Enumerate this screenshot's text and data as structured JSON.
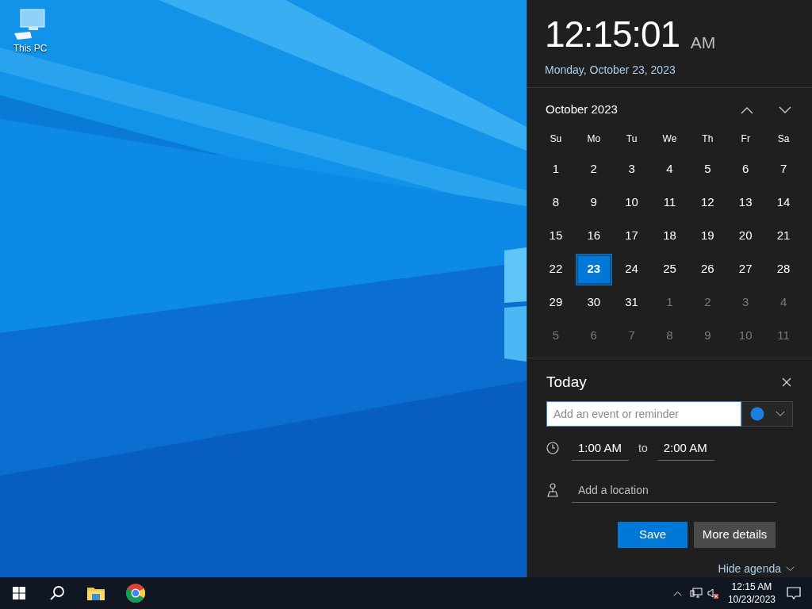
{
  "desktop": {
    "icons": [
      {
        "label": "This PC"
      }
    ]
  },
  "clock": {
    "time": "12:15:01",
    "period": "AM",
    "date": "Monday, October 23, 2023"
  },
  "calendar": {
    "month": "October 2023",
    "weekdays": [
      "Su",
      "Mo",
      "Tu",
      "We",
      "Th",
      "Fr",
      "Sa"
    ],
    "days": [
      {
        "label": "1",
        "in_month": true,
        "selected": false
      },
      {
        "label": "2",
        "in_month": true,
        "selected": false
      },
      {
        "label": "3",
        "in_month": true,
        "selected": false
      },
      {
        "label": "4",
        "in_month": true,
        "selected": false
      },
      {
        "label": "5",
        "in_month": true,
        "selected": false
      },
      {
        "label": "6",
        "in_month": true,
        "selected": false
      },
      {
        "label": "7",
        "in_month": true,
        "selected": false
      },
      {
        "label": "8",
        "in_month": true,
        "selected": false
      },
      {
        "label": "9",
        "in_month": true,
        "selected": false
      },
      {
        "label": "10",
        "in_month": true,
        "selected": false
      },
      {
        "label": "11",
        "in_month": true,
        "selected": false
      },
      {
        "label": "12",
        "in_month": true,
        "selected": false
      },
      {
        "label": "13",
        "in_month": true,
        "selected": false
      },
      {
        "label": "14",
        "in_month": true,
        "selected": false
      },
      {
        "label": "15",
        "in_month": true,
        "selected": false
      },
      {
        "label": "16",
        "in_month": true,
        "selected": false
      },
      {
        "label": "17",
        "in_month": true,
        "selected": false
      },
      {
        "label": "18",
        "in_month": true,
        "selected": false
      },
      {
        "label": "19",
        "in_month": true,
        "selected": false
      },
      {
        "label": "20",
        "in_month": true,
        "selected": false
      },
      {
        "label": "21",
        "in_month": true,
        "selected": false
      },
      {
        "label": "22",
        "in_month": true,
        "selected": false
      },
      {
        "label": "23",
        "in_month": true,
        "selected": true
      },
      {
        "label": "24",
        "in_month": true,
        "selected": false
      },
      {
        "label": "25",
        "in_month": true,
        "selected": false
      },
      {
        "label": "26",
        "in_month": true,
        "selected": false
      },
      {
        "label": "27",
        "in_month": true,
        "selected": false
      },
      {
        "label": "28",
        "in_month": true,
        "selected": false
      },
      {
        "label": "29",
        "in_month": true,
        "selected": false
      },
      {
        "label": "30",
        "in_month": true,
        "selected": false
      },
      {
        "label": "31",
        "in_month": true,
        "selected": false
      },
      {
        "label": "1",
        "in_month": false,
        "selected": false
      },
      {
        "label": "2",
        "in_month": false,
        "selected": false
      },
      {
        "label": "3",
        "in_month": false,
        "selected": false
      },
      {
        "label": "4",
        "in_month": false,
        "selected": false
      },
      {
        "label": "5",
        "in_month": false,
        "selected": false
      },
      {
        "label": "6",
        "in_month": false,
        "selected": false
      },
      {
        "label": "7",
        "in_month": false,
        "selected": false
      },
      {
        "label": "8",
        "in_month": false,
        "selected": false
      },
      {
        "label": "9",
        "in_month": false,
        "selected": false
      },
      {
        "label": "10",
        "in_month": false,
        "selected": false
      },
      {
        "label": "11",
        "in_month": false,
        "selected": false
      }
    ]
  },
  "agenda": {
    "title": "Today",
    "event_field": {
      "placeholder": "Add an event or reminder"
    },
    "start_time": "1:00 AM",
    "separator": "to",
    "end_time": "2:00 AM",
    "location_field": {
      "placeholder": "Add a location"
    },
    "buttons": [
      {
        "label": "Save",
        "kind": "primary"
      },
      {
        "label": "More details",
        "kind": "secondary"
      }
    ],
    "hide_link": "Hide agenda"
  },
  "taskbar": {
    "tray": {
      "volume_muted": true,
      "time": "12:15 AM",
      "date": "10/23/2023"
    }
  }
}
